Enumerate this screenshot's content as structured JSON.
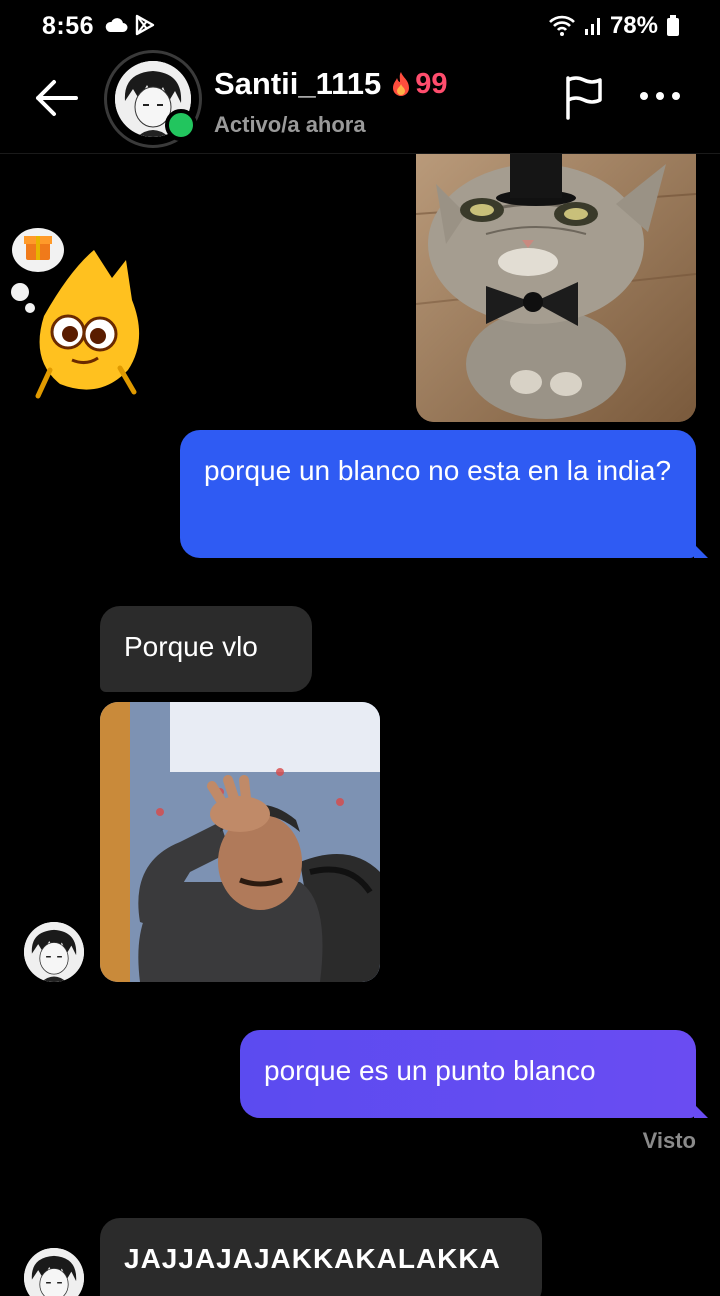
{
  "status_bar": {
    "time": "8:56",
    "battery": "78%",
    "icons": [
      "cloud-icon",
      "play-store-icon",
      "wifi-icon",
      "signal-icon",
      "battery-icon"
    ]
  },
  "header": {
    "contact_name": "Santii_1115",
    "streak_count": "99",
    "status": "Activo/a ahora",
    "online_color": "#22c55e",
    "streak_color": "#ff4d6d"
  },
  "messages": [
    {
      "side": "out",
      "type": "image",
      "subject": "cat with top hat and bow tie"
    },
    {
      "side": "in",
      "type": "sticker",
      "subject": "yellow mascot with gift"
    },
    {
      "side": "out",
      "type": "text",
      "text": "porque un blanco no esta en la india?"
    },
    {
      "side": "in",
      "type": "text",
      "text": "Porque vlo"
    },
    {
      "side": "in",
      "type": "image",
      "subject": "man with hand on forehead"
    },
    {
      "side": "out",
      "type": "text",
      "text": "porque es un punto blanco"
    },
    {
      "side": "in",
      "type": "text",
      "text": "JAJJAJAJAKKAKALAKKA"
    }
  ],
  "seen_label": "Visto",
  "colors": {
    "outgoing_bubble": "#2f5bf3",
    "outgoing_bubble_gradient_end": "#6a4cf2",
    "incoming_bubble": "#2b2b2b",
    "background": "#000000"
  }
}
